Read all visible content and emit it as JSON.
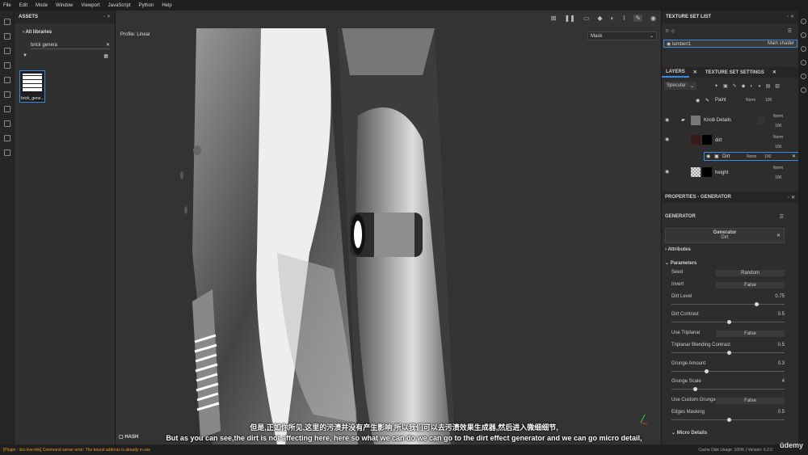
{
  "menu": [
    "File",
    "Edit",
    "Mode",
    "Window",
    "Viewport",
    "JavaScript",
    "Python",
    "Help"
  ],
  "assets": {
    "title": "ASSETS",
    "library": "All libraries",
    "search_value": "brick genera",
    "thumb_label": "brick_gene..."
  },
  "viewport": {
    "profile": "Profile: Linear",
    "mode_select": "Mask",
    "hash_label": "HASH"
  },
  "texture_set_list": {
    "title": "TEXTURE SET LIST",
    "item": "lambert1",
    "shader": "Main shader"
  },
  "tabs": {
    "layers": "LAYERS",
    "settings": "TEXTURE SET SETTINGS"
  },
  "layers": {
    "channel": "Specular",
    "items": [
      {
        "name": "Paint",
        "blend": "Norm",
        "opacity": "100"
      },
      {
        "name": "Knob Details",
        "blend": "Norm",
        "opacity": "100"
      },
      {
        "name": "dirt",
        "blend": "Norm",
        "opacity": "100"
      },
      {
        "name": "Dirt",
        "blend": "Norm",
        "opacity": "100"
      },
      {
        "name": "height",
        "blend": "Norm",
        "opacity": "100"
      }
    ]
  },
  "properties": {
    "title": "PROPERTIES - GENERATOR",
    "section": "GENERATOR",
    "gen_name": "Generator",
    "gen_sub": "Dirt",
    "attributes": "Attributes",
    "parameters": "Parameters",
    "micro": "Micro Details",
    "params": [
      {
        "label": "Seed",
        "value": "Random"
      },
      {
        "label": "Invert",
        "value": "False"
      },
      {
        "label": "Dirt Level",
        "value": "0.75"
      },
      {
        "label": "Dirt Contrast",
        "value": "0.5"
      },
      {
        "label": "Use Triplanar",
        "value": "False"
      },
      {
        "label": "Triplanar Blending Contrast",
        "value": "0.5"
      },
      {
        "label": "Grunge Amount",
        "value": "0.3"
      },
      {
        "label": "Grunge Scale",
        "value": "4"
      },
      {
        "label": "Use Custom Grunge",
        "value": "False"
      },
      {
        "label": "Edges Masking",
        "value": "0.5"
      }
    ]
  },
  "subtitles": {
    "cn": "但是,正如你所见,这里的污渍并没有产生影响,所以我们可以去污渍效果生成器,然后进入微细细节,",
    "en": "But as you can see,the dirt is not affecting here, here so what we can do we can go to the dirt effect generator and we can go micro detail,"
  },
  "status": {
    "error": "[Plugin - dcc-live-link] Command server error: The bound address is already in use",
    "cache": "Cache Disk Usage: 100% | Version: 6.2.0"
  },
  "watermark": "ûdemy"
}
